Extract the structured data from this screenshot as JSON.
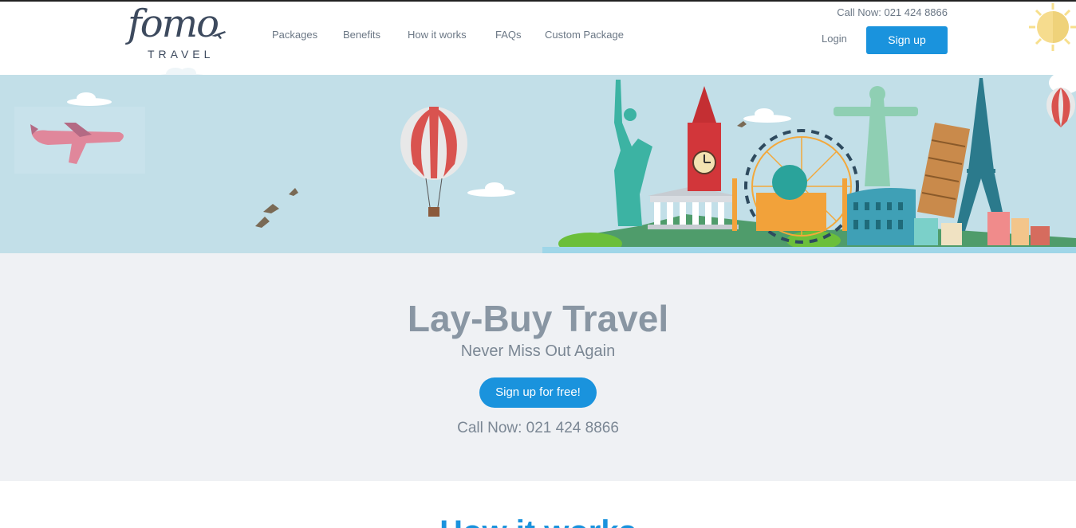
{
  "brand": {
    "logo_word": "fomo",
    "logo_sub": "TRAVEL"
  },
  "nav": [
    {
      "label": "Packages"
    },
    {
      "label": "Benefits"
    },
    {
      "label": "How it works"
    },
    {
      "label": "FAQs"
    },
    {
      "label": "Custom Package"
    }
  ],
  "header": {
    "call_now": "Call Now: 021 424 8866",
    "login_label": "Login",
    "signup_label": "Sign up"
  },
  "hero": {
    "title": "Lay-Buy Travel",
    "subtitle": "Never Miss Out Again",
    "cta_label": "Sign up for free!",
    "call_now": "Call Now: 021 424 8866"
  },
  "next_section": {
    "title": "How it works"
  },
  "colors": {
    "accent": "#1a93dd",
    "sky": "#c2dfe8",
    "section_bg": "#eff1f4",
    "heading_gray": "#8996a3"
  }
}
